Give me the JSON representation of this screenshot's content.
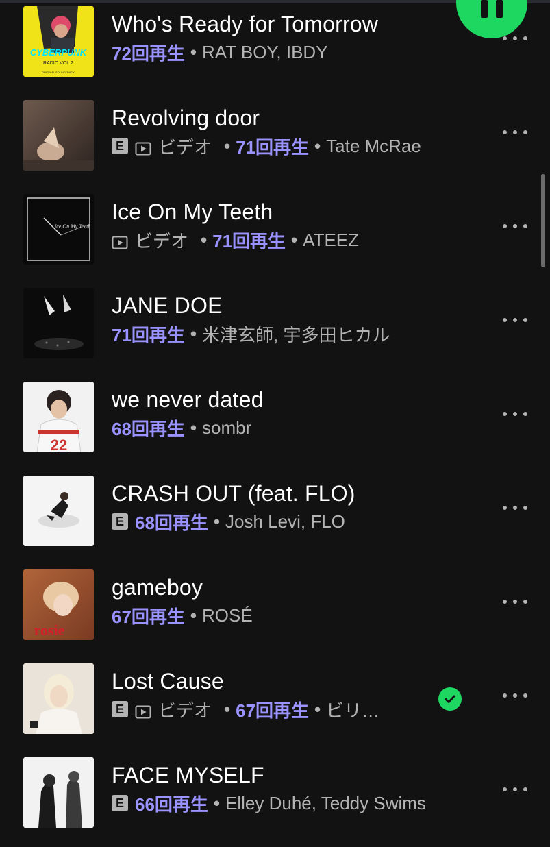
{
  "ui": {
    "colors": {
      "background": "#121212",
      "accent_green": "#1ed760",
      "plays_color": "#9a93ff",
      "secondary_text": "#b3b3b3"
    },
    "player": {
      "play_pause_state": "pause-icon"
    },
    "explicit_badge": "E",
    "video_label": "ビデオ",
    "separator": "•"
  },
  "tracks": [
    {
      "title": "Who's Ready for Tomorrow",
      "plays": "72回再生",
      "artists": "RAT BOY, IBDY",
      "explicit": false,
      "video": false,
      "downloaded": false,
      "cover_text_main": "CYBERPUNK",
      "cover_text_sub": "RADIO VOL.2",
      "cover_text_small": "ORIGINAL SOUNDTRACK"
    },
    {
      "title": "Revolving door",
      "plays": "71回再生",
      "artists": "Tate McRae",
      "explicit": true,
      "video": true,
      "downloaded": false
    },
    {
      "title": "Ice On My Teeth",
      "plays": "71回再生",
      "artists": "ATEEZ",
      "explicit": false,
      "video": true,
      "downloaded": false,
      "cover_text_main": "Ice On My Teeth"
    },
    {
      "title": "JANE DOE",
      "plays": "71回再生",
      "artists": "米津玄師, 宇多田ヒカル",
      "explicit": false,
      "video": false,
      "downloaded": false
    },
    {
      "title": "we never dated",
      "plays": "68回再生",
      "artists": "sombr",
      "explicit": false,
      "video": false,
      "downloaded": false,
      "cover_text_main": "22"
    },
    {
      "title": "CRASH OUT (feat. FLO)",
      "plays": "68回再生",
      "artists": "Josh Levi, FLO",
      "explicit": true,
      "video": false,
      "downloaded": false
    },
    {
      "title": "gameboy",
      "plays": "67回再生",
      "artists": "ROSÉ",
      "explicit": false,
      "video": false,
      "downloaded": false,
      "cover_text_main": "rosie"
    },
    {
      "title": "Lost Cause",
      "plays": "67回再生",
      "artists": "ビリ…",
      "explicit": true,
      "video": true,
      "downloaded": true
    },
    {
      "title": "FACE MYSELF",
      "plays": "66回再生",
      "artists": "Elley Duhé, Teddy Swims",
      "explicit": true,
      "video": false,
      "downloaded": false
    }
  ]
}
